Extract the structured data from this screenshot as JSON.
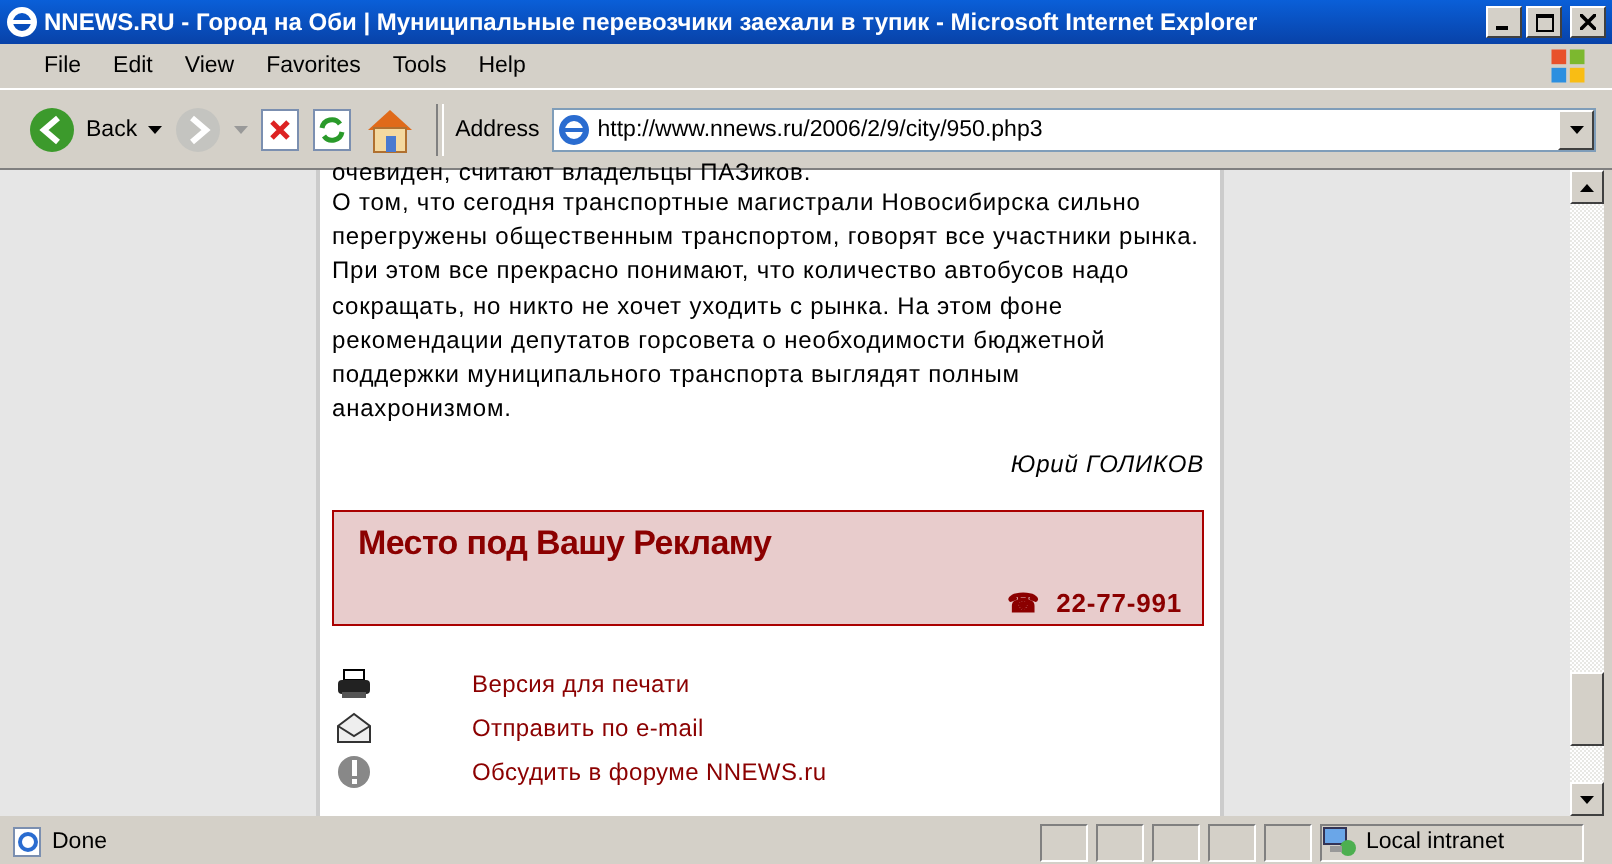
{
  "window": {
    "title": "NNEWS.RU - Город на Оби | Муниципальные перевозчики заехали в тупик - Microsoft Internet Explorer"
  },
  "menu": [
    "File",
    "Edit",
    "View",
    "Favorites",
    "Tools",
    "Help"
  ],
  "toolbar": {
    "back_label": "Back",
    "address_label": "Address",
    "address": "http://www.nnews.ru/2006/2/9/city/950.php3"
  },
  "article": {
    "cut_line": "очевиден, считают владельцы ПАЗиков.",
    "paragraph": "О том, что сегодня транспортные магистрали Новосибирска сильно перегружены общественным транспортом, говорят все участники рынка. При этом все прекрасно понимают, что количество автобусов надо сокращать, но никто не хочет уходить с рынка. На этом фоне рекомендации депутатов горсовета о необходимости бюджетной поддержки муниципального транспорта выглядят полным анахронизмом.",
    "author": "Юрий ГОЛИКОВ"
  },
  "ad": {
    "title": "Место под Вашу Рекламу",
    "phone_icon": "☎",
    "phone": "22-77-991"
  },
  "links": [
    {
      "kind": "print",
      "label": "Версия для печати"
    },
    {
      "kind": "email",
      "label": "Отправить по e-mail"
    },
    {
      "kind": "forum",
      "label": "Обсудить в форуме NNEWS.ru"
    }
  ],
  "status_bar": {
    "text": "Done",
    "zone": "Local intranet"
  }
}
